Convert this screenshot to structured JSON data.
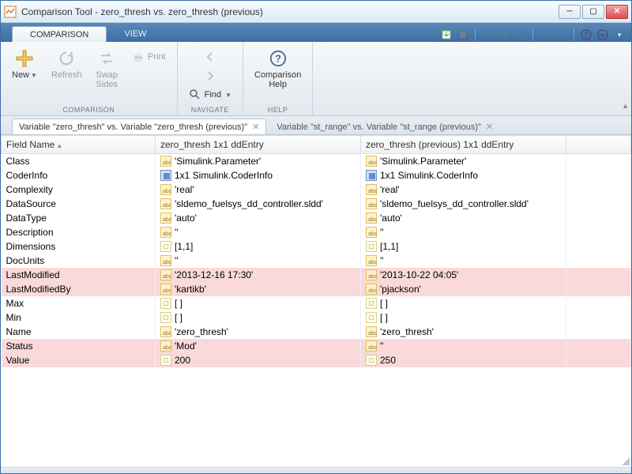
{
  "window": {
    "title": "Comparison Tool - zero_thresh vs. zero_thresh (previous)"
  },
  "ribbon_tabs": {
    "comparison": "COMPARISON",
    "view": "VIEW"
  },
  "ribbon": {
    "new": "New",
    "refresh": "Refresh",
    "swap": "Swap\nSides",
    "print": "Print",
    "find": "Find",
    "help": "Comparison\nHelp",
    "group_comparison": "COMPARISON",
    "group_navigate": "NAVIGATE",
    "group_help": "HELP"
  },
  "doc_tabs": {
    "tab1": "Variable \"zero_thresh\" vs. Variable \"zero_thresh (previous)\"",
    "tab2": "Variable \"st_range\" vs. Variable \"st_range (previous)\""
  },
  "headers": {
    "field": "Field Name",
    "left": "zero_thresh 1x1 ddEntry",
    "right": "zero_thresh (previous) 1x1 ddEntry"
  },
  "rows": [
    {
      "field": "Class",
      "icon": "abc",
      "left": "'Simulink.Parameter'",
      "right": "'Simulink.Parameter'",
      "diff": false
    },
    {
      "field": "CoderInfo",
      "icon": "obj",
      "left": "1x1 Simulink.CoderInfo",
      "right": "1x1 Simulink.CoderInfo",
      "diff": false
    },
    {
      "field": "Complexity",
      "icon": "abc",
      "left": "'real'",
      "right": "'real'",
      "diff": false
    },
    {
      "field": "DataSource",
      "icon": "abc",
      "left": "'sldemo_fuelsys_dd_controller.sldd'",
      "right": "'sldemo_fuelsys_dd_controller.sldd'",
      "diff": false
    },
    {
      "field": "DataType",
      "icon": "abc",
      "left": "'auto'",
      "right": "'auto'",
      "diff": false
    },
    {
      "field": "Description",
      "icon": "abc",
      "left": "''",
      "right": "''",
      "diff": false
    },
    {
      "field": "Dimensions",
      "icon": "mat",
      "left": "[1,1]",
      "right": "[1,1]",
      "diff": false
    },
    {
      "field": "DocUnits",
      "icon": "abc",
      "left": "''",
      "right": "''",
      "diff": false
    },
    {
      "field": "LastModified",
      "icon": "abc",
      "left": "'2013-12-16 17:30'",
      "right": "'2013-10-22 04:05'",
      "diff": true
    },
    {
      "field": "LastModifiedBy",
      "icon": "abc",
      "left": "'kartikb'",
      "right": "'pjackson'",
      "diff": true
    },
    {
      "field": "Max",
      "icon": "mat",
      "left": "[ ]",
      "right": "[ ]",
      "diff": false
    },
    {
      "field": "Min",
      "icon": "mat",
      "left": "[ ]",
      "right": "[ ]",
      "diff": false
    },
    {
      "field": "Name",
      "icon": "abc",
      "left": "'zero_thresh'",
      "right": "'zero_thresh'",
      "diff": false
    },
    {
      "field": "Status",
      "icon": "abc",
      "left": "'Mod'",
      "right": "''",
      "diff": true
    },
    {
      "field": "Value",
      "icon": "mat",
      "left": "200",
      "right": "250",
      "diff": true
    }
  ]
}
